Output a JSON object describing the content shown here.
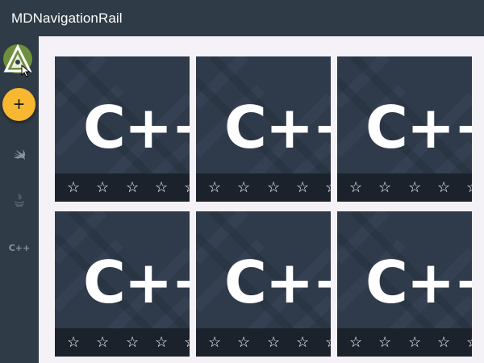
{
  "app": {
    "title": "MDNavigationRail"
  },
  "rail": {
    "logo_icon": "kivymd-logo-icon",
    "fab": {
      "label": "+",
      "icon": "plus-icon",
      "color": "#f7b731"
    },
    "items": [
      {
        "icon": "swift-icon"
      },
      {
        "icon": "java-icon"
      },
      {
        "icon": "cpp-icon",
        "text": "C++"
      }
    ]
  },
  "cards": [
    {
      "label": "C++",
      "stars": [
        "☆",
        "☆",
        "☆",
        "☆",
        "☆"
      ]
    },
    {
      "label": "C++",
      "stars": [
        "☆",
        "☆",
        "☆",
        "☆",
        "☆"
      ]
    },
    {
      "label": "C++",
      "stars": [
        "☆",
        "☆",
        "☆",
        "☆",
        "☆"
      ]
    },
    {
      "label": "C++",
      "stars": [
        "☆",
        "☆",
        "☆",
        "☆",
        "☆"
      ]
    },
    {
      "label": "C++",
      "stars": [
        "☆",
        "☆",
        "☆",
        "☆",
        "☆"
      ]
    },
    {
      "label": "C++",
      "stars": [
        "☆",
        "☆",
        "☆",
        "☆",
        "☆"
      ]
    }
  ],
  "colors": {
    "toolbar": "#2f3b46",
    "card_bg": "#2f3a4a",
    "star_bar": "#1b222b",
    "content_bg": "#f4f2f6"
  }
}
